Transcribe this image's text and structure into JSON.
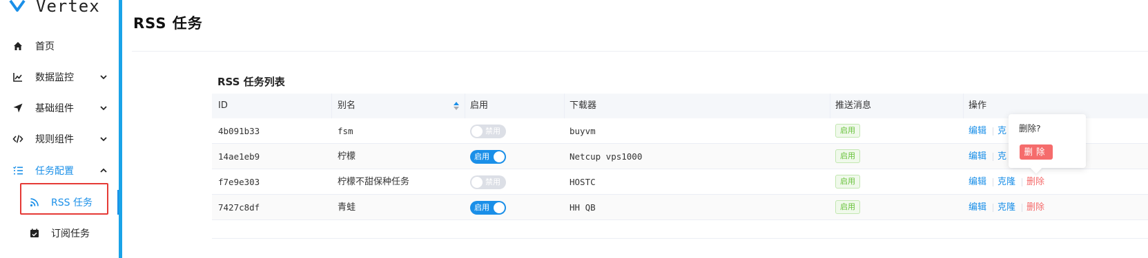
{
  "app": {
    "name": "Vertex"
  },
  "colors": {
    "accent": "#1a8fe8",
    "danger": "#f56c6c",
    "success": "#67c23a",
    "highlight_box": "#e53935"
  },
  "sidebar": {
    "items": [
      {
        "label": "首页",
        "icon": "home-icon"
      },
      {
        "label": "数据监控",
        "icon": "chart-line-icon"
      },
      {
        "label": "基础组件",
        "icon": "send-icon"
      },
      {
        "label": "规则组件",
        "icon": "code-icon"
      },
      {
        "label": "任务配置",
        "icon": "task-list-icon"
      }
    ],
    "subitems": [
      {
        "label": "RSS 任务",
        "icon": "rss-icon"
      },
      {
        "label": "订阅任务",
        "icon": "calendar-icon"
      }
    ]
  },
  "page": {
    "title": "RSS 任务"
  },
  "table": {
    "title": "RSS 任务列表",
    "headers": {
      "id": "ID",
      "alias": "别名",
      "enabled": "启用",
      "downloader": "下载器",
      "push": "推送消息",
      "actions": "操作"
    },
    "rows": [
      {
        "id": "4b091b33",
        "alias": "fsm",
        "enabled": false,
        "switch_label": "禁用",
        "downloader": "buyvm",
        "push": "启用"
      },
      {
        "id": "14ae1eb9",
        "alias": "柠檬",
        "enabled": true,
        "switch_label": "启用",
        "downloader": "Netcup vps1000",
        "push": "启用"
      },
      {
        "id": "f7e9e303",
        "alias": "柠檬不甜保种任务",
        "enabled": false,
        "switch_label": "禁用",
        "downloader": "HOSTC",
        "push": "启用"
      },
      {
        "id": "7427c8df",
        "alias": "青蛙",
        "enabled": true,
        "switch_label": "启用",
        "downloader": "HH QB",
        "push": "启用"
      }
    ],
    "actions": {
      "edit": "编辑",
      "clone": "克隆",
      "delete": "删除"
    },
    "clone_truncated": "克"
  },
  "popconfirm": {
    "question": "删除?",
    "confirm": "删除"
  }
}
